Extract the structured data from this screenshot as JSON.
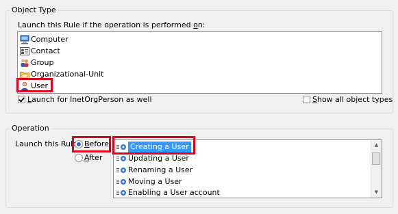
{
  "object_type": {
    "title": "Object Type",
    "prompt_before": "Launch this Rule if the operation is performed ",
    "prompt_accel": "o",
    "prompt_after": "n:",
    "items": [
      {
        "label": "Computer",
        "icon": "computer-icon"
      },
      {
        "label": "Contact",
        "icon": "contact-icon"
      },
      {
        "label": "Group",
        "icon": "group-icon"
      },
      {
        "label": "Organizational-Unit",
        "icon": "organizational-unit-icon"
      },
      {
        "label": "User",
        "icon": "user-icon",
        "highlighted": true
      }
    ],
    "inetorgperson": {
      "accel": "L",
      "label": "aunch for InetOrgPerson as well",
      "checked": true
    },
    "show_all": {
      "accel": "S",
      "label": "how all object types",
      "checked": false
    }
  },
  "operation": {
    "title": "Operation",
    "launch_label": "Launch this Rule",
    "before": {
      "accel": "B",
      "label": "efore",
      "selected": true
    },
    "after": {
      "accel": "A",
      "label": "fter",
      "selected": false
    },
    "items": [
      {
        "label": "Creating a User",
        "selected": true
      },
      {
        "label": "Updating a User"
      },
      {
        "label": "Renaming a User"
      },
      {
        "label": "Moving a User"
      },
      {
        "label": "Enabling a User account"
      }
    ]
  },
  "colors": {
    "highlight": "#e0001b",
    "selection": "#3399ff",
    "radio_dot": "#2a62c9"
  }
}
